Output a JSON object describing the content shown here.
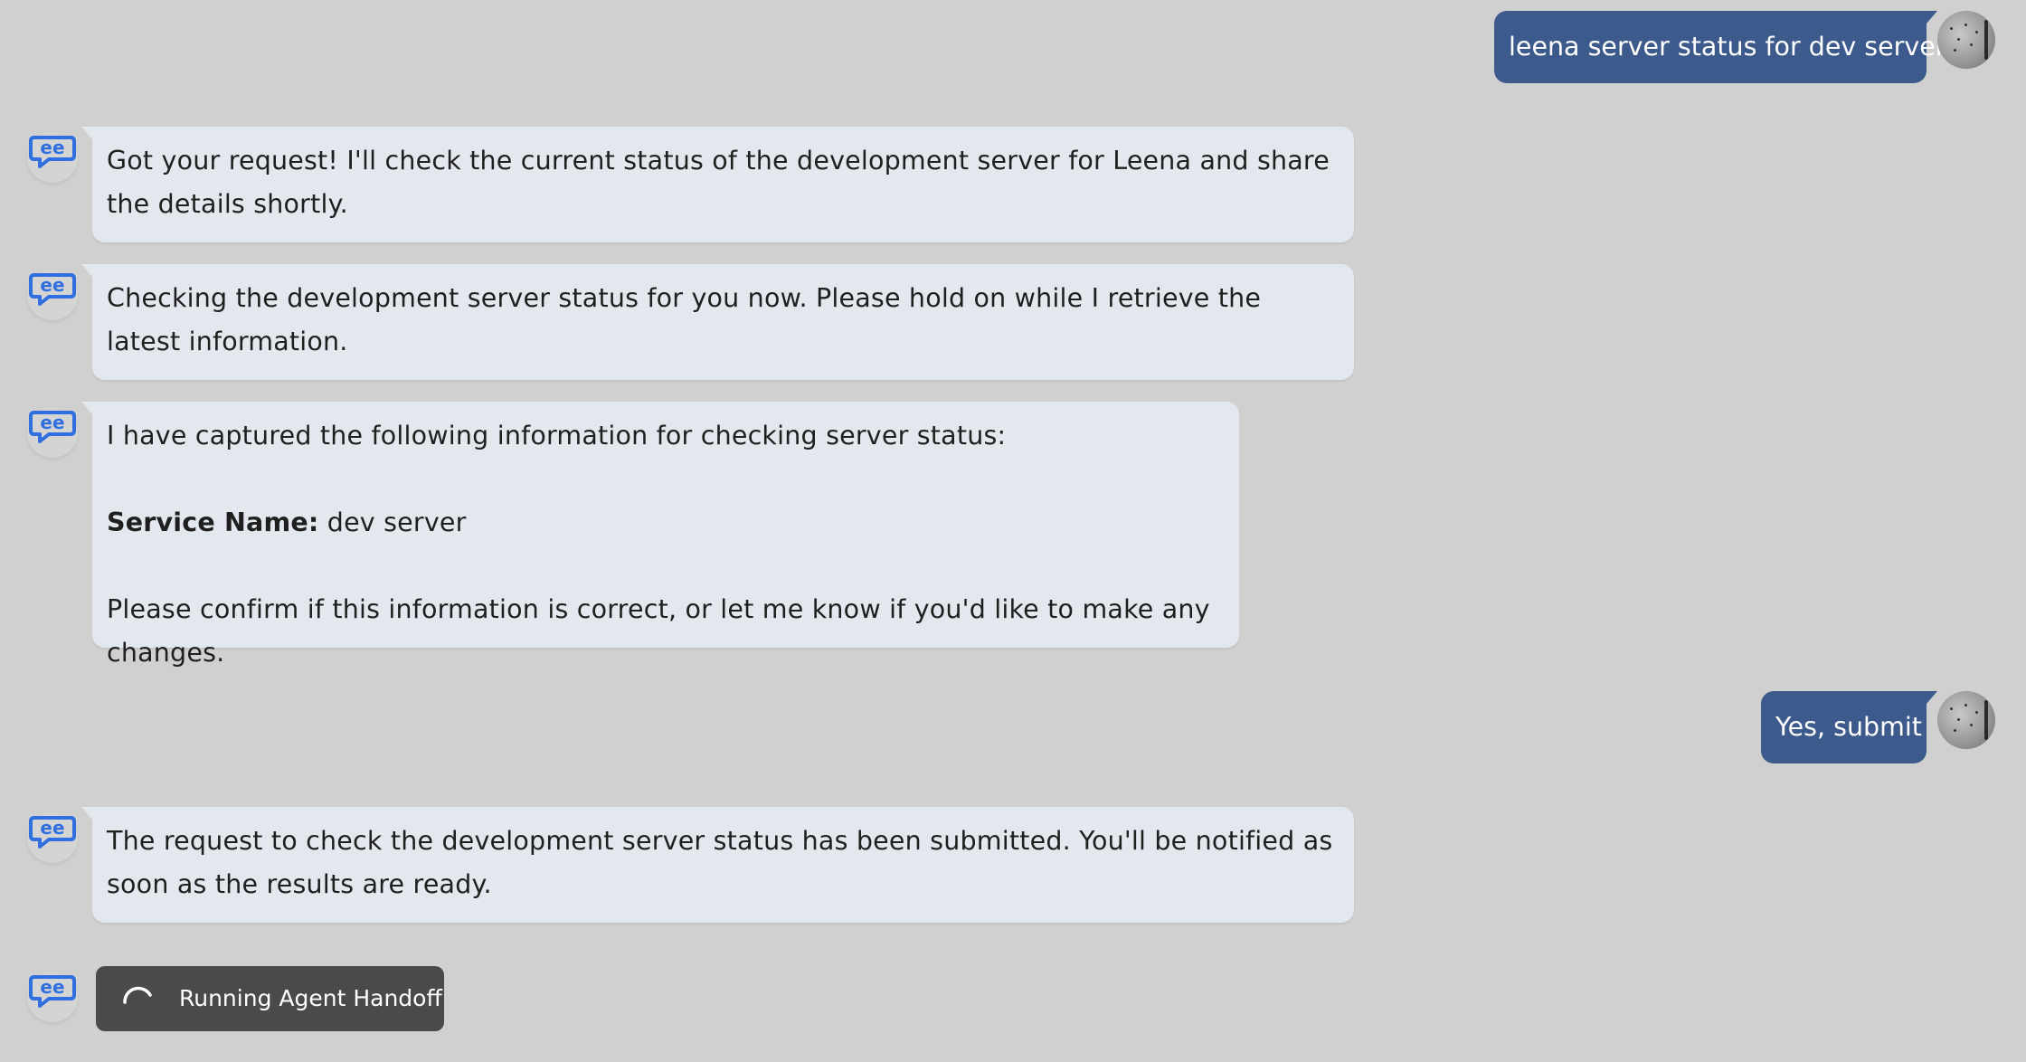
{
  "conversation": {
    "user_messages": [
      {
        "text": "leena server status for dev server"
      },
      {
        "text": "Yes, submit"
      }
    ],
    "bot_messages": [
      {
        "text": "Got your request! I'll check the current status of the development server for Leena and share the details shortly."
      },
      {
        "text": "Checking the development server status for you now. Please hold on while I retrieve the latest information."
      },
      {
        "intro": "I have captured the following information for checking server status:",
        "field_label": "Service Name:",
        "field_value": " dev server",
        "outro": "Please confirm if this information is correct, or let me know if you'd like to make any changes."
      },
      {
        "text": "The request to check the development server status has been submitted. You'll be notified as soon as the results are ready."
      }
    ],
    "status": {
      "label": "Running Agent Handoff"
    }
  },
  "icons": {
    "bot_avatar": "chat-bubble-logo-icon",
    "user_avatar": "user-avatar",
    "spinner": "loading-spinner-icon"
  },
  "colors": {
    "background": "#d0d0d0",
    "bot_bubble": "#e3e8ef",
    "user_bubble": "#3c5a8c",
    "status_chip": "#4a4a4a",
    "bot_logo": "#2f6fe0"
  }
}
